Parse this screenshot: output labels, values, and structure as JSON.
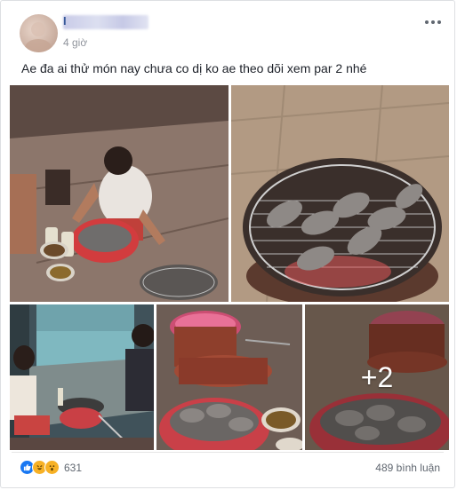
{
  "post": {
    "author_initial": "I",
    "time": "4 giờ",
    "text": "Ae đa ai thử món nay chưa co dị ko ae theo dõi xem par 2 nhé"
  },
  "photos": {
    "extra_count": "+2"
  },
  "footer": {
    "reaction_count": "631",
    "comments": "489 bình luận"
  },
  "icons": {
    "more": "more-options-icon",
    "like": "like-reaction-icon",
    "haha": "haha-reaction-icon",
    "wow": "wow-reaction-icon"
  },
  "colors": {
    "link": "#365899",
    "meta": "#90949c",
    "like": "#1877f2",
    "emoji": "#f7b125"
  }
}
